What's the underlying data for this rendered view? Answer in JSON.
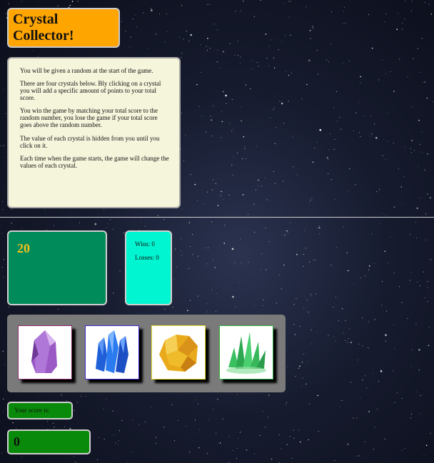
{
  "header": {
    "title": "Crystal Collector!"
  },
  "instructions": [
    "You will be given a random at the start of the game.",
    "There are four crystals below. Bly clicking on a crystal you will add a specific amount of points to your total score.",
    "You win the game by matching your total score to the random number, you lose the game if your total score goes above the random number.",
    "The value of each crystal is hidden from you until you click on it.",
    "Each time when the game starts, the game will change the values of each crystal."
  ],
  "game": {
    "target_number": "20"
  },
  "stats": {
    "wins": "Wins: 0",
    "losses": "Losses: 0"
  },
  "crystals": [
    {
      "icon": "purple-crystal-icon",
      "color": "#9b59c6",
      "border": "#8a2a6a"
    },
    {
      "icon": "blue-crystal-icon",
      "color": "#2a6cf0",
      "border": "#3a2ad0"
    },
    {
      "icon": "yellow-crystal-icon",
      "color": "#e8aa1a",
      "border": "#e8e02a"
    },
    {
      "icon": "green-crystal-icon",
      "color": "#3ac060",
      "border": "#2ab040"
    }
  ],
  "score": {
    "label": "Your score is:",
    "value": "0"
  },
  "colors": {
    "title_bg": "#ffa500",
    "instructions_bg": "#f5f5dc",
    "target_bg": "#008b5a",
    "target_text": "#f0c020",
    "stats_bg": "#00f5d0",
    "crystal_panel_bg": "#7a7a7a",
    "score_bg": "#0a8a0a"
  }
}
